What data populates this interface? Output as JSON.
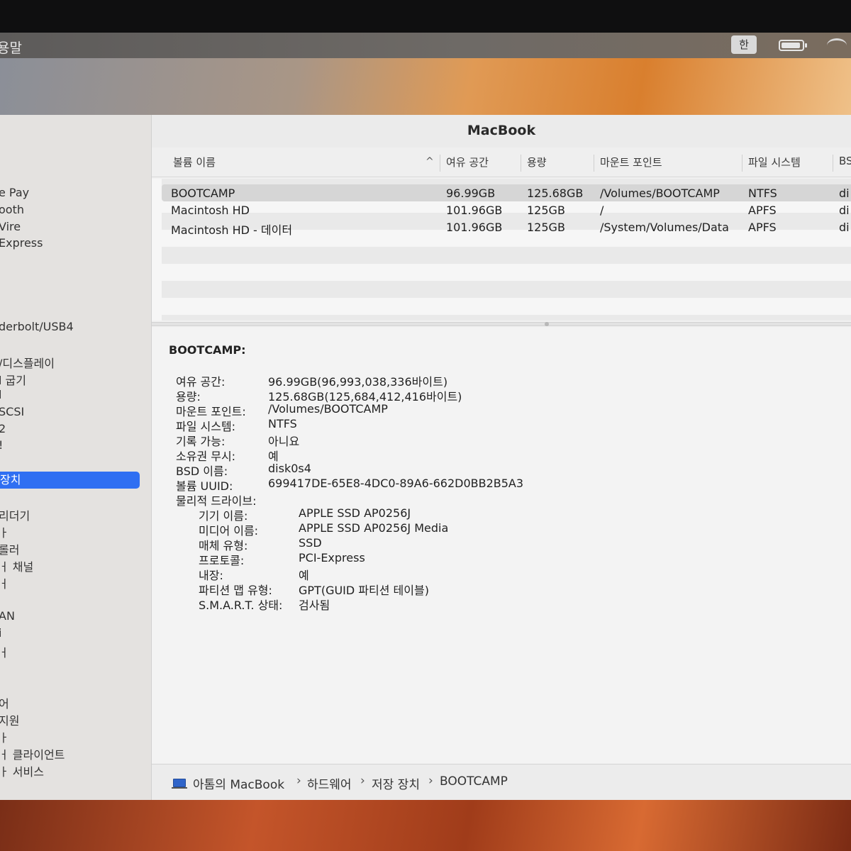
{
  "menubar": {
    "app_title": "용말",
    "input_source": "한",
    "battery_icon": "battery-icon",
    "wifi_icon": "wifi-icon"
  },
  "sidebar": {
    "items": [
      "e Pay",
      "ooth",
      "Vire",
      "Express",
      "",
      "derbolt/USB4",
      "/디스플레이",
      "l 굽기",
      "l",
      "SCSI",
      "2",
      "!",
      "장치",
      "리더기",
      "ㅏ",
      "롤러",
      "ㅓ 채널",
      "ㅓ",
      "AN",
      "i",
      "ㅓ",
      "어",
      "지원",
      "ㅏ",
      "ㅓ 클라이언트",
      "ㅏ 서비스"
    ],
    "selected_index": 12
  },
  "window": {
    "title": "MacBook"
  },
  "table": {
    "columns": [
      "볼륨 이름",
      "여유 공간",
      "용량",
      "마운트 포인트",
      "파일 시스템",
      "BS"
    ],
    "rows": [
      {
        "name": "BOOTCAMP",
        "free": "96.99GB",
        "capacity": "125.68GB",
        "mount": "/Volumes/BOOTCAMP",
        "fs": "NTFS",
        "bsd": "di"
      },
      {
        "name": "Macintosh HD",
        "free": "101.96GB",
        "capacity": "125GB",
        "mount": "/",
        "fs": "APFS",
        "bsd": "di"
      },
      {
        "name": "Macintosh HD - 데이터",
        "free": "101.96GB",
        "capacity": "125GB",
        "mount": "/System/Volumes/Data",
        "fs": "APFS",
        "bsd": "di"
      }
    ]
  },
  "detail": {
    "title": "BOOTCAMP:",
    "fields": [
      {
        "k": "여유 공간:",
        "v": "96.99GB(96,993,038,336바이트)"
      },
      {
        "k": "용량:",
        "v": "125.68GB(125,684,412,416바이트)"
      },
      {
        "k": "마운트 포인트:",
        "v": "/Volumes/BOOTCAMP"
      },
      {
        "k": "파일 시스템:",
        "v": "NTFS"
      },
      {
        "k": "기록 가능:",
        "v": "아니요"
      },
      {
        "k": "소유권 무시:",
        "v": "예"
      },
      {
        "k": "BSD 이름:",
        "v": "disk0s4"
      },
      {
        "k": "볼륨 UUID:",
        "v": "699417DE-65E8-4DC0-89A6-662D0BB2B5A3"
      },
      {
        "k": "물리적 드라이브:",
        "v": ""
      }
    ],
    "drive_fields": [
      {
        "k": "기기 이름:",
        "v": "APPLE SSD AP0256J"
      },
      {
        "k": "미디어 이름:",
        "v": "APPLE SSD AP0256J Media"
      },
      {
        "k": "매체 유형:",
        "v": "SSD"
      },
      {
        "k": "프로토콜:",
        "v": "PCI-Express"
      },
      {
        "k": "내장:",
        "v": "예"
      },
      {
        "k": "파티션 맵 유형:",
        "v": "GPT(GUID 파티션 테이블)"
      },
      {
        "k": "S.M.A.R.T. 상태:",
        "v": "검사됨"
      }
    ]
  },
  "breadcrumb": {
    "items": [
      "아톰의 MacBook",
      "하드웨어",
      "저장 장치",
      "BOOTCAMP"
    ],
    "separator": "›"
  },
  "colors": {
    "selection_blue": "#2f6ff2",
    "row_selected": "#d6d6d6"
  }
}
